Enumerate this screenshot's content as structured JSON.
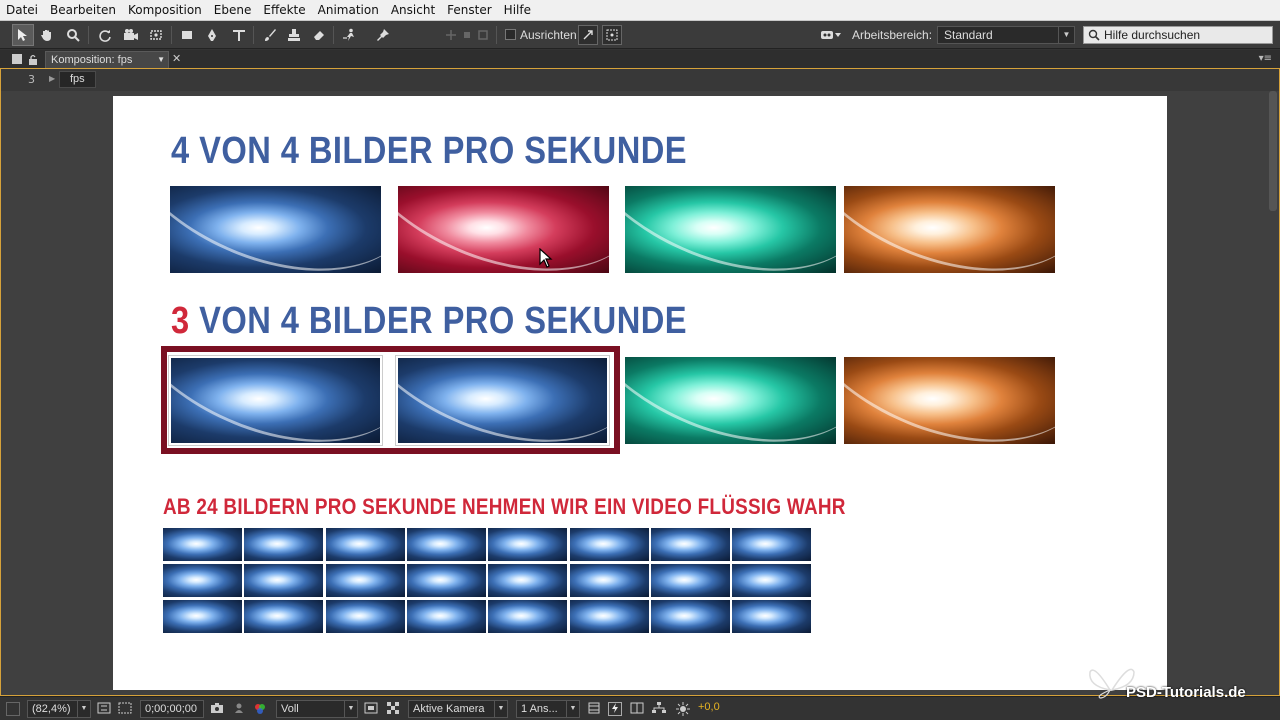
{
  "menu": [
    "Datei",
    "Bearbeiten",
    "Komposition",
    "Ebene",
    "Effekte",
    "Animation",
    "Ansicht",
    "Fenster",
    "Hilfe"
  ],
  "toolbar": {
    "align_label": "Ausrichten",
    "workspace_label": "Arbeitsbereich:",
    "workspace_value": "Standard",
    "search_placeholder": "Hilfe durchsuchen"
  },
  "panel": {
    "tab_label": "Komposition: fps",
    "breadcrumb_number": "3",
    "breadcrumb_label": "fps"
  },
  "composition": {
    "heading1": "4 VON 4 BILDER PRO SEKUNDE",
    "heading2_number": "3",
    "heading2_rest": " VON 4 BILDER PRO SEKUNDE",
    "heading3": "AB 24 BILDERN PRO SEKUNDE NEHMEN WIR EIN VIDEO FLÜSSIG WAHR",
    "row1_colors": [
      "blue",
      "red",
      "teal",
      "orange"
    ],
    "row2_colors": [
      "blue",
      "blue",
      "teal",
      "orange"
    ],
    "grid_rows": 3,
    "grid_cols": 8
  },
  "bottombar": {
    "zoom": "(82,4%)",
    "timecode": "0;00;00;00",
    "resolution": "Voll",
    "camera": "Aktive Kamera",
    "views": "1 Ans...",
    "exposure": "+0,0"
  },
  "watermark": "PSD-Tutorials.de",
  "colors": {
    "heading_blue": "#3f5fa0",
    "heading_red": "#d0283a",
    "highlight_border": "#7a1022",
    "panel_accent": "#d6a23a"
  }
}
